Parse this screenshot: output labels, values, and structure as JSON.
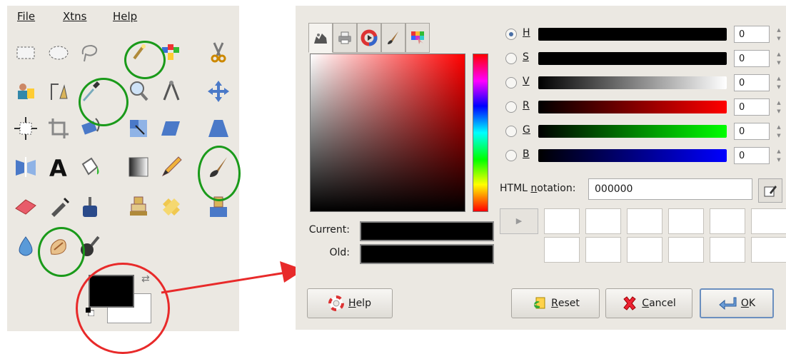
{
  "menu": [
    {
      "label": "File"
    },
    {
      "label": "Xtns"
    },
    {
      "label": "Help"
    }
  ],
  "tools": [
    "rect-select-icon",
    "ellipse-select-icon",
    "lasso-icon",
    "fuzzy-select-icon",
    "color-select-icon",
    "scissors-icon",
    "foreground-select-icon",
    "paths-icon",
    "color-picker-icon",
    "magnify-icon",
    "measure-icon",
    "move-icon",
    "align-icon",
    "crop-icon",
    "rotate-icon",
    "scale-icon",
    "shear-icon",
    "perspective-icon",
    "flip-icon",
    "text-icon",
    "bucket-fill-icon",
    "blend-icon",
    "pencil-icon",
    "paintbrush-icon",
    "eraser-icon",
    "airbrush-icon",
    "ink-icon",
    "clone-icon",
    "heal-icon",
    "perspective-clone-icon",
    "blur-icon",
    "smudge-icon",
    "dodge-burn-icon"
  ],
  "dialog": {
    "swatches": {
      "current_label": "Current:",
      "old_label": "Old:",
      "current_color": "#000000",
      "old_color": "#000000"
    },
    "channels": [
      {
        "key": "H",
        "selected": true,
        "value": "0",
        "color": "#000000"
      },
      {
        "key": "S",
        "selected": false,
        "value": "0",
        "color": "#000000"
      },
      {
        "key": "V",
        "selected": false,
        "value": "0",
        "color": "#000000"
      },
      {
        "key": "R",
        "selected": false,
        "value": "0",
        "color": "#ff0000"
      },
      {
        "key": "G",
        "selected": false,
        "value": "0",
        "color": "#00ff00"
      },
      {
        "key": "B",
        "selected": false,
        "value": "0",
        "color": "#0000ff"
      }
    ],
    "html_notation": {
      "label_pre": "HTML ",
      "label_u": "n",
      "label_post": "otation:",
      "value": "000000"
    },
    "buttons": {
      "help": {
        "u": "H",
        "rest": "elp"
      },
      "reset": {
        "u": "R",
        "rest": "eset"
      },
      "cancel": {
        "u": "C",
        "rest": "ancel"
      },
      "ok": {
        "u": "O",
        "rest": "K"
      }
    }
  },
  "colors": {
    "highlight": "#1a9a1a",
    "annotation": "#e82a2a",
    "selected_radio": "#4a6fa5"
  }
}
